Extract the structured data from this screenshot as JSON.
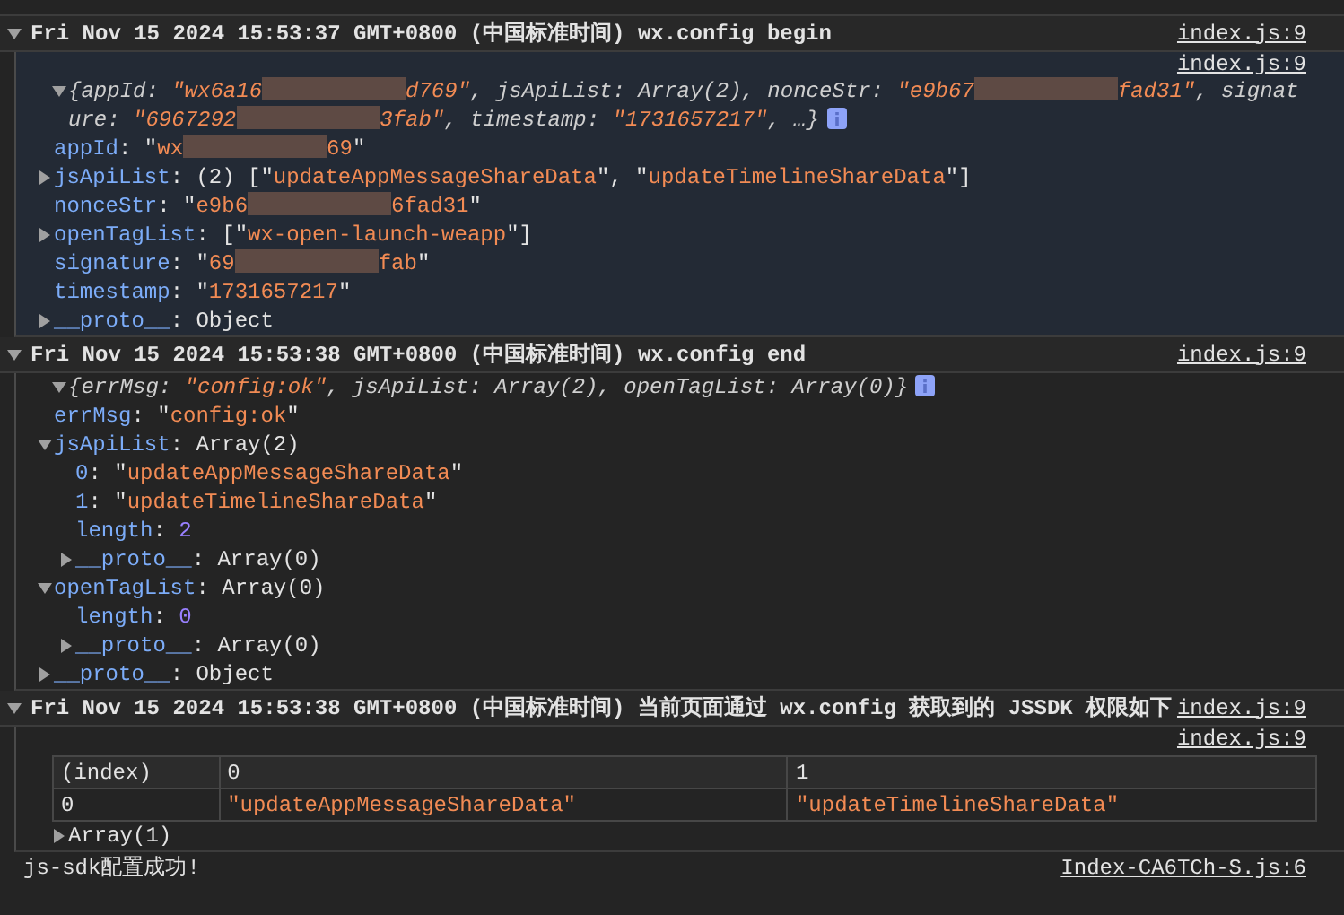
{
  "messages": [
    {
      "kind": "group",
      "header": "Fri Nov 15 2024 15:53:37 GMT+0800 (中国标准时间) wx.config begin",
      "source": "index.js:9",
      "expanded": true,
      "highlighted": true,
      "entries": [
        {
          "kind": "object",
          "source": "index.js:9",
          "tree": {
            "expanded": true,
            "info": true,
            "tokens": [
              {
                "kind": "plain",
                "text": "{appId: "
              },
              {
                "kind": "string",
                "text": "\"wx6a16"
              },
              {
                "kind": "redacted"
              },
              {
                "kind": "string",
                "text": "d769\""
              },
              {
                "kind": "plain",
                "text": ", jsApiList: Array(2), nonceStr: "
              },
              {
                "kind": "string",
                "text": "\"e9b67"
              },
              {
                "kind": "redacted"
              },
              {
                "kind": "string",
                "text": "fad31\""
              },
              {
                "kind": "plain",
                "text": ", signature: "
              },
              {
                "kind": "string",
                "text": "\"6967292"
              },
              {
                "kind": "redacted"
              },
              {
                "kind": "string",
                "text": "3fab\""
              },
              {
                "kind": "plain",
                "text": ", timestamp: "
              },
              {
                "kind": "string",
                "text": "\"1731657217\""
              },
              {
                "kind": "plain",
                "text": ", …}"
              }
            ],
            "children": [
              {
                "tokens": [
                  {
                    "kind": "key",
                    "text": "appId"
                  },
                  {
                    "kind": "plain",
                    "text": ": \""
                  },
                  {
                    "kind": "string",
                    "text": "wx"
                  },
                  {
                    "kind": "redacted"
                  },
                  {
                    "kind": "string",
                    "text": "69"
                  },
                  {
                    "kind": "plain",
                    "text": "\""
                  }
                ]
              },
              {
                "expanded": false,
                "tokens": [
                  {
                    "kind": "key",
                    "text": "jsApiList"
                  },
                  {
                    "kind": "plain",
                    "text": ": (2) [\""
                  },
                  {
                    "kind": "string",
                    "text": "updateAppMessageShareData"
                  },
                  {
                    "kind": "plain",
                    "text": "\", \""
                  },
                  {
                    "kind": "string",
                    "text": "updateTimelineShareData"
                  },
                  {
                    "kind": "plain",
                    "text": "\"]"
                  }
                ]
              },
              {
                "tokens": [
                  {
                    "kind": "key",
                    "text": "nonceStr"
                  },
                  {
                    "kind": "plain",
                    "text": ": \""
                  },
                  {
                    "kind": "string",
                    "text": "e9b6"
                  },
                  {
                    "kind": "redacted"
                  },
                  {
                    "kind": "string",
                    "text": "6fad31"
                  },
                  {
                    "kind": "plain",
                    "text": "\""
                  }
                ]
              },
              {
                "expanded": false,
                "tokens": [
                  {
                    "kind": "key",
                    "text": "openTagList"
                  },
                  {
                    "kind": "plain",
                    "text": ": [\""
                  },
                  {
                    "kind": "string",
                    "text": "wx-open-launch-weapp"
                  },
                  {
                    "kind": "plain",
                    "text": "\"]"
                  }
                ]
              },
              {
                "tokens": [
                  {
                    "kind": "key",
                    "text": "signature"
                  },
                  {
                    "kind": "plain",
                    "text": ": \""
                  },
                  {
                    "kind": "string",
                    "text": "69"
                  },
                  {
                    "kind": "redacted"
                  },
                  {
                    "kind": "string",
                    "text": "fab"
                  },
                  {
                    "kind": "plain",
                    "text": "\""
                  }
                ]
              },
              {
                "tokens": [
                  {
                    "kind": "key",
                    "text": "timestamp"
                  },
                  {
                    "kind": "plain",
                    "text": ": \""
                  },
                  {
                    "kind": "string",
                    "text": "1731657217"
                  },
                  {
                    "kind": "plain",
                    "text": "\""
                  }
                ]
              },
              {
                "expanded": false,
                "tokens": [
                  {
                    "kind": "key",
                    "text": "__proto__"
                  },
                  {
                    "kind": "plain",
                    "text": ": Object"
                  }
                ]
              }
            ]
          }
        }
      ]
    },
    {
      "kind": "group",
      "header": "Fri Nov 15 2024 15:53:38 GMT+0800 (中国标准时间) wx.config end",
      "source": "index.js:9",
      "expanded": true,
      "highlighted": false,
      "entries": [
        {
          "kind": "object",
          "tree": {
            "expanded": true,
            "info": true,
            "tokens": [
              {
                "kind": "plain",
                "text": "{errMsg: "
              },
              {
                "kind": "string",
                "text": "\"config:ok\""
              },
              {
                "kind": "plain",
                "text": ", jsApiList: Array(2), openTagList: Array(0)}"
              }
            ],
            "children": [
              {
                "tokens": [
                  {
                    "kind": "key",
                    "text": "errMsg"
                  },
                  {
                    "kind": "plain",
                    "text": ": \""
                  },
                  {
                    "kind": "string",
                    "text": "config:ok"
                  },
                  {
                    "kind": "plain",
                    "text": "\""
                  }
                ]
              },
              {
                "expanded": true,
                "tokens": [
                  {
                    "kind": "key",
                    "text": "jsApiList"
                  },
                  {
                    "kind": "plain",
                    "text": ": Array(2)"
                  }
                ],
                "children": [
                  {
                    "tokens": [
                      {
                        "kind": "key",
                        "text": "0"
                      },
                      {
                        "kind": "plain",
                        "text": ": \""
                      },
                      {
                        "kind": "string",
                        "text": "updateAppMessageShareData"
                      },
                      {
                        "kind": "plain",
                        "text": "\""
                      }
                    ]
                  },
                  {
                    "tokens": [
                      {
                        "kind": "key",
                        "text": "1"
                      },
                      {
                        "kind": "plain",
                        "text": ": \""
                      },
                      {
                        "kind": "string",
                        "text": "updateTimelineShareData"
                      },
                      {
                        "kind": "plain",
                        "text": "\""
                      }
                    ]
                  },
                  {
                    "tokens": [
                      {
                        "kind": "key",
                        "text": "length"
                      },
                      {
                        "kind": "plain",
                        "text": ": "
                      },
                      {
                        "kind": "number",
                        "text": "2"
                      }
                    ]
                  },
                  {
                    "expanded": false,
                    "tokens": [
                      {
                        "kind": "key",
                        "text": "__proto__"
                      },
                      {
                        "kind": "plain",
                        "text": ": Array(0)"
                      }
                    ]
                  }
                ]
              },
              {
                "expanded": true,
                "tokens": [
                  {
                    "kind": "key",
                    "text": "openTagList"
                  },
                  {
                    "kind": "plain",
                    "text": ": Array(0)"
                  }
                ],
                "children": [
                  {
                    "tokens": [
                      {
                        "kind": "key",
                        "text": "length"
                      },
                      {
                        "kind": "plain",
                        "text": ": "
                      },
                      {
                        "kind": "number",
                        "text": "0"
                      }
                    ]
                  },
                  {
                    "expanded": false,
                    "tokens": [
                      {
                        "kind": "key",
                        "text": "__proto__"
                      },
                      {
                        "kind": "plain",
                        "text": ": Array(0)"
                      }
                    ]
                  }
                ]
              },
              {
                "expanded": false,
                "tokens": [
                  {
                    "kind": "key",
                    "text": "__proto__"
                  },
                  {
                    "kind": "plain",
                    "text": ": Object"
                  }
                ]
              }
            ]
          }
        }
      ]
    },
    {
      "kind": "group",
      "header": "Fri Nov 15 2024 15:53:38 GMT+0800 (中国标准时间) 当前页面通过 wx.config 获取到的 JSSDK 权限如下",
      "source": "index.js:9",
      "expanded": true,
      "highlighted": false,
      "entries": [
        {
          "kind": "table",
          "source": "index.js:9",
          "columns": [
            "(index)",
            "0",
            "1"
          ],
          "rows": [
            [
              {
                "kind": "plain",
                "text": "0"
              },
              {
                "kind": "string",
                "text": "\"updateAppMessageShareData\""
              },
              {
                "kind": "string",
                "text": "\"updateTimelineShareData\""
              }
            ]
          ],
          "footer": {
            "expanded": false,
            "tokens": [
              {
                "kind": "plain",
                "text": "Array(1)"
              }
            ]
          }
        }
      ]
    },
    {
      "kind": "log",
      "text": "js-sdk配置成功!",
      "source": "Index-CA6TCh-S.js:6"
    }
  ]
}
